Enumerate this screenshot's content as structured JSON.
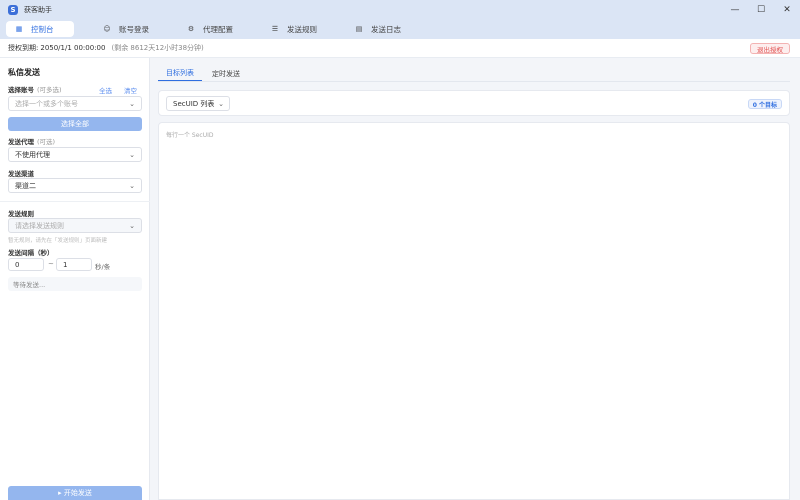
{
  "window": {
    "title": "获客助手",
    "logo": "S",
    "minimize": "—",
    "maximize": "☐",
    "close": "✕"
  },
  "nav": {
    "tabs": [
      {
        "label": "控制台",
        "icon": "grid-icon",
        "glyph": "▦"
      },
      {
        "label": "账号登录",
        "icon": "user-icon",
        "glyph": "☺"
      },
      {
        "label": "代理配置",
        "icon": "gear-icon",
        "glyph": "⚙"
      },
      {
        "label": "发送规则",
        "icon": "list-icon",
        "glyph": "☰"
      },
      {
        "label": "发送日志",
        "icon": "log-icon",
        "glyph": "▤"
      }
    ]
  },
  "license": {
    "label": "授权到期:",
    "date": "2050/1/1 00:00:00",
    "remaining": "(剩余 8612天12小时38分钟)",
    "logout": "退出授权"
  },
  "left": {
    "title": "私信发送",
    "account": {
      "label": "选择账号",
      "optional": "(可多选)",
      "select_all_link": "全选",
      "clear_link": "清空",
      "placeholder": "选择一个或多个账号"
    },
    "select_all_button": "选择全部",
    "proxy": {
      "label": "发送代理",
      "optional": "(可选)",
      "value": "不使用代理"
    },
    "channel": {
      "label": "发送渠道",
      "value": "渠道二"
    },
    "rule": {
      "label": "发送规则",
      "placeholder": "请选择发送规则",
      "hint": "暂无规则，请先在「发送规则」页面新建"
    },
    "interval": {
      "label": "发送间隔（秒）",
      "min": "0",
      "separator": "~",
      "max": "1",
      "unit": "秒/条"
    },
    "status": "等待发送...",
    "start_button": "▸ 开始发送"
  },
  "main": {
    "tabs": [
      "目标列表",
      "定时发送"
    ],
    "type_select": "SecUID 列表",
    "count_badge": "0 个目标",
    "editor_placeholder": "每行一个 SecUID"
  },
  "colors": {
    "accent": "#2f6ee0",
    "button_disabled": "#94b6ee",
    "danger": "#e05050",
    "titlebar": "#dbe5f5"
  }
}
